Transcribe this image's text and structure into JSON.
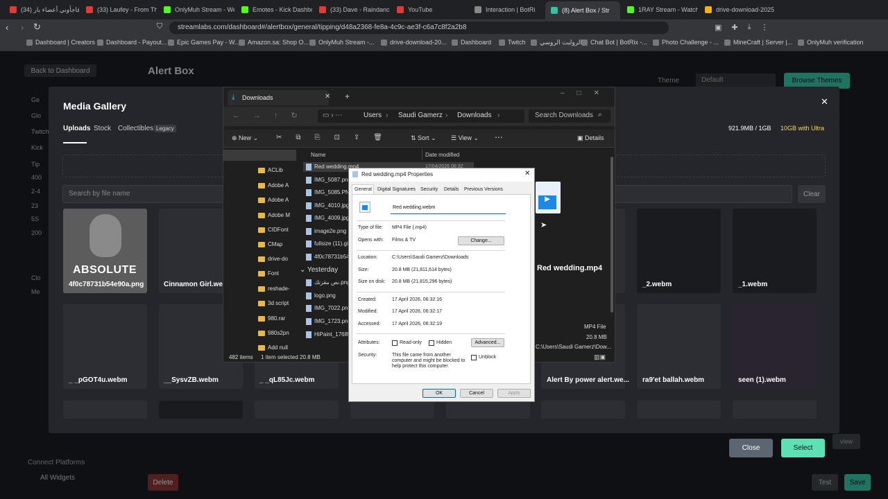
{
  "browser": {
    "tabs": [
      {
        "label": "(34) فاجأوني أعضاء بار",
        "color": "#e53935"
      },
      {
        "label": "(33) Laufey - From The",
        "color": "#e53935"
      },
      {
        "label": "OnlyMuh Stream - We",
        "color": "#53fc18"
      },
      {
        "label": "Emotes - Kick Dashbo",
        "color": "#53fc18"
      },
      {
        "label": "(33) Dave - Raindance",
        "color": "#e53935"
      },
      {
        "label": "YouTube",
        "color": "#e53935"
      },
      {
        "label": "Interaction | BotRi",
        "color": "#888888"
      },
      {
        "label": "(8) Alert Box / Str",
        "color": "#31c3a2"
      },
      {
        "label": "1RAY Stream - Watch",
        "color": "#53fc18"
      },
      {
        "label": "drive-download-2025",
        "color": "#f4b400"
      }
    ],
    "url": "streamlabs.com/dashboard#/alertbox/general/tipping/d48a2368-fe8a-4c9c-ae3f-c6a7c8f2a2b8",
    "bookmarks": [
      "Dashboard | Creators",
      "Dashboard - Payout...",
      "Epic Games Pay - W...",
      "Amazon.sa: Shop O...",
      "OnlyMuh Stream -...",
      "drive-download-20...",
      "Dashboard",
      "Twitch",
      "الرولبت الروسي",
      "Chat Bot | BotRix -...",
      "Photo Challenge - ...",
      "MineCraft | Server |...",
      "OnlyMuh verification"
    ]
  },
  "page": {
    "back_label": "Back to Dashboard",
    "title": "Alert Box",
    "theme_label": "Theme",
    "theme_value": "Default",
    "browse_themes": "Browse Themes",
    "sidebar": [
      "Ge",
      "Glo",
      "Twitch",
      "Kick",
      "Tip",
      "400",
      "2-4",
      "23",
      "5S",
      "200",
      "Clo",
      "Me"
    ],
    "connect_platforms": "Connect Platforms",
    "all_widgets": "All Widgets",
    "delete": "Delete",
    "test": "Test",
    "save": "Save",
    "preview": "view"
  },
  "gallery": {
    "title": "Media Gallery",
    "tabs": [
      "Uploads",
      "Stock",
      "Collectibles"
    ],
    "legacy_badge": "Legacy",
    "storage": "921.9MB / 1GB",
    "ultra": "10GB with Ultra",
    "search_placeholder": "Search by file name",
    "clear": "Clear",
    "close": "Close",
    "select": "Select",
    "row1": [
      "4f0c78731b54e90a.png",
      "Cinnamon Girl.webm",
      "_2.webm",
      "_1.webm"
    ],
    "row2": [
      "_ _pGOT4u.webm",
      "__SysvZB.webm",
      "_ _qL85Jc.webm",
      "Alert By power alert.we...",
      "ra9'et ballah.webm",
      "seen (1).webm"
    ],
    "absolute_text": "ABSOLUTE"
  },
  "explorer": {
    "tab_title": "Downloads",
    "breadcrumb": [
      "Users",
      "Saudi Gamerz",
      "Downloads"
    ],
    "search_placeholder": "Search Downloads",
    "toolbar": {
      "new": "New",
      "sort": "Sort",
      "view": "View",
      "details": "Details"
    },
    "nav": [
      "Downloads",
      "ACLib",
      "Adobe A",
      "Adobe A",
      "Adobe M",
      "CIDFont",
      "CMap",
      "drive-do",
      "Font",
      "reshade-",
      "3d script",
      "980.rar",
      "980s2pn",
      "Add null"
    ],
    "columns": {
      "name": "Name",
      "date": "Date modified"
    },
    "files": [
      "Red wedding.mp4",
      "IMG_5087.png",
      "IMG_5085.PNG",
      "IMG_4010.jpg",
      "IMG_4009.jpg",
      "image2e.png",
      "fullsize (11).gi",
      "4f0c78731b54"
    ],
    "group_yesterday": "Yesterday",
    "files2": [
      "نص مقزتك.png",
      "logo.png",
      "IMG_7022.png",
      "IMG_1723.png",
      "HiPaint_17685"
    ],
    "date_first": "17/04/2026 06:32",
    "status_items": "482 items",
    "status_selected": "1 item selected  20.8 MB",
    "preview_name": "Red wedding.mp4",
    "preview_type": "MP4 File",
    "preview_size": "20.8 MB",
    "preview_path": "C:\\Users\\Saudi Gamerz\\Dow..."
  },
  "properties": {
    "title": "Red wedding.mp4 Properties",
    "tabs": [
      "General",
      "Digital Signatures",
      "Security",
      "Details",
      "Previous Versions"
    ],
    "filename": "Red wedding.webm",
    "type_label": "Type of file:",
    "type_value": "MP4 File (.mp4)",
    "opens_label": "Opens with:",
    "opens_value": "Films & TV",
    "change": "Change...",
    "location_label": "Location:",
    "location_value": "C:\\Users\\Saudi Gamerz\\Downloads",
    "size_label": "Size:",
    "size_value": "20.8 MB (21,811,614 bytes)",
    "disk_label": "Size on disk:",
    "disk_value": "20.8 MB (21,815,296 bytes)",
    "created_label": "Created:",
    "created_value": "17 April 2026, 06:32:16",
    "modified_label": "Modified:",
    "modified_value": "17 April 2026, 06:32:17",
    "accessed_label": "Accessed:",
    "accessed_value": "17 April 2026, 06:32:19",
    "attributes_label": "Attributes:",
    "readonly": "Read-only",
    "hidden": "Hidden",
    "advanced": "Advanced...",
    "security_label": "Security:",
    "security_text": "This file came from another computer and might be blocked to help protect this computer.",
    "unblock": "Unblock",
    "ok": "OK",
    "cancel": "Cancel",
    "apply": "Apply"
  }
}
